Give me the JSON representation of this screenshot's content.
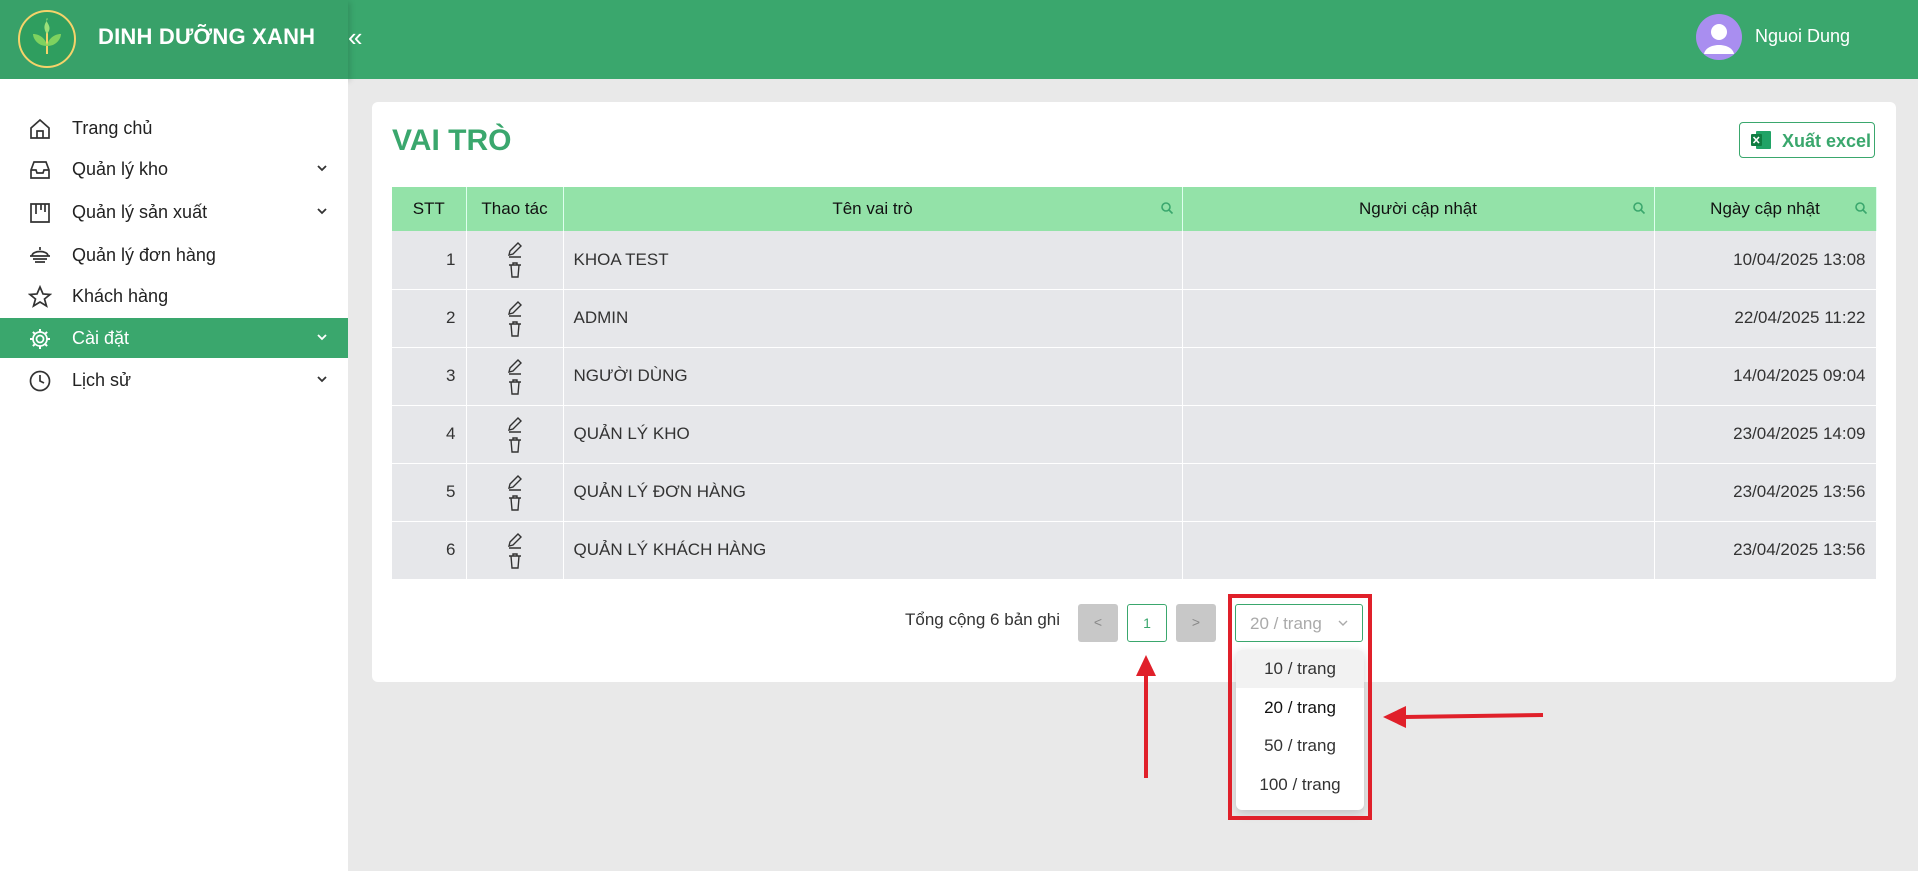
{
  "header": {
    "brand": "DINH DƯỠNG XANH",
    "user_name": "Nguoi Dung"
  },
  "sidebar": {
    "items": [
      {
        "label": "Trang chủ",
        "icon": "home-icon"
      },
      {
        "label": "Quản lý kho",
        "icon": "inbox-icon"
      },
      {
        "label": "Quản lý sản xuất",
        "icon": "factory-icon"
      },
      {
        "label": "Quản lý đơn hàng",
        "icon": "order-icon"
      },
      {
        "label": "Khách hàng",
        "icon": "star-icon"
      },
      {
        "label": "Cài đặt",
        "icon": "gear-icon"
      },
      {
        "label": "Lịch sử",
        "icon": "clock-icon"
      }
    ]
  },
  "main": {
    "title": "VAI TRÒ",
    "export_label": "Xuất excel",
    "table": {
      "headers": [
        "STT",
        "Thao tác",
        "Tên vai trò",
        "Người cập nhật",
        "Ngày cập nhật"
      ],
      "rows": [
        {
          "stt": "1",
          "name": "KHOA TEST",
          "updater": "",
          "date": "10/04/2025 13:08"
        },
        {
          "stt": "2",
          "name": "ADMIN",
          "updater": "",
          "date": "22/04/2025 11:22"
        },
        {
          "stt": "3",
          "name": "NGƯỜI DÙNG",
          "updater": "",
          "date": "14/04/2025 09:04"
        },
        {
          "stt": "4",
          "name": "QUẢN LÝ KHO",
          "updater": "",
          "date": "23/04/2025 14:09"
        },
        {
          "stt": "5",
          "name": "QUẢN LÝ ĐƠN HÀNG",
          "updater": "",
          "date": "23/04/2025 13:56"
        },
        {
          "stt": "6",
          "name": "QUẢN LÝ KHÁCH HÀNG",
          "updater": "",
          "date": "23/04/2025 13:56"
        }
      ]
    },
    "pagination": {
      "total_text": "Tổng cộng 6 bản ghi",
      "current_page": "1",
      "prev": "<",
      "next": ">",
      "page_size": "20 / trang",
      "options": [
        "10 / trang",
        "20 / trang",
        "50 / trang",
        "100 / trang"
      ]
    }
  },
  "colors": {
    "brand_green": "#3aa76d",
    "header_row": "#93e2a8",
    "annotation_red": "#e0202a"
  }
}
